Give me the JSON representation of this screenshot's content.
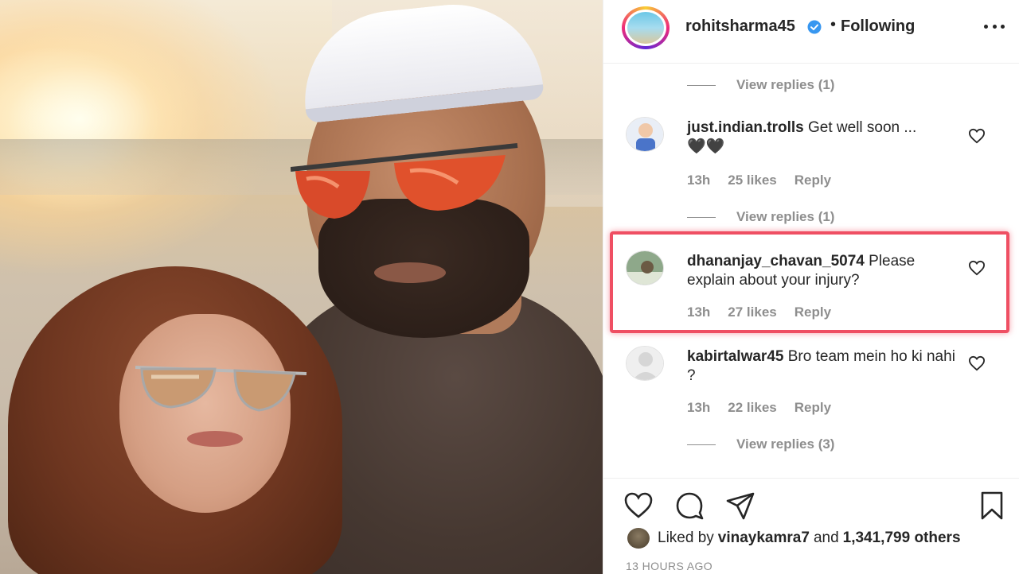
{
  "post": {
    "username": "rohitsharma45",
    "follow_status": "Following",
    "separator": "•",
    "verified": true
  },
  "comments": [
    {
      "type": "view_replies",
      "label": "View replies (1)"
    },
    {
      "type": "comment",
      "username": "just.indian.trolls",
      "text": "Get well soon ...",
      "emoji": "🖤🖤",
      "time": "13h",
      "likes": "25 likes",
      "reply_label": "Reply"
    },
    {
      "type": "view_replies",
      "label": "View replies (1)"
    },
    {
      "type": "comment",
      "username": "dhananjay_chavan_5074",
      "text": "Please explain about your injury?",
      "time": "13h",
      "likes": "27 likes",
      "reply_label": "Reply",
      "highlighted": true
    },
    {
      "type": "comment",
      "username": "kabirtalwar45",
      "text": "Bro team mein ho ki nahi ?",
      "time": "13h",
      "likes": "22 likes",
      "reply_label": "Reply"
    },
    {
      "type": "view_replies",
      "label": "View replies (3)"
    }
  ],
  "actions": {
    "icons": [
      "heart-icon",
      "comment-icon",
      "share-icon",
      "bookmark-icon"
    ]
  },
  "likes_summary": {
    "prefix": "Liked by",
    "user": "vinaykamra7",
    "middle": "and",
    "count": "1,341,799 others"
  },
  "timestamp": "13 HOURS AGO",
  "colors": {
    "highlight": "#ef4f63",
    "verified": "#3897f0",
    "muted": "#8e8e8e",
    "text": "#262626"
  }
}
